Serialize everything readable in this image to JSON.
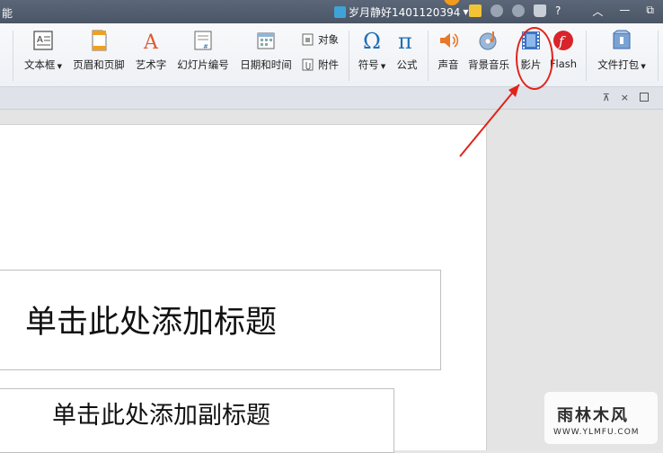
{
  "titlebar": {
    "app_fragment": "能",
    "user": "岁月静好1401120394",
    "help": "?",
    "min": "—",
    "max": "⧉"
  },
  "ribbon": {
    "text_box": "文本框",
    "header_footer": "页眉和页脚",
    "wordart": "艺术字",
    "slide_number": "幻灯片编号",
    "date_time": "日期和时间",
    "object": "对象",
    "attachment": "附件",
    "symbol": "符号",
    "formula": "公式",
    "sound": "声音",
    "bg_music": "背景音乐",
    "movie": "影片",
    "flash": "Flash",
    "package": "文件打包"
  },
  "toolbar2": {
    "pin": "⊼",
    "close": "×"
  },
  "slide": {
    "title_placeholder": "单击此处添加标题",
    "subtitle_placeholder": "单击此处添加副标题"
  },
  "watermark": {
    "main": "雨林木风",
    "sub": "WWW.YLMFU.COM"
  },
  "colors": {
    "annotation": "#e2231a",
    "titlebar": "#4f5b6b"
  }
}
